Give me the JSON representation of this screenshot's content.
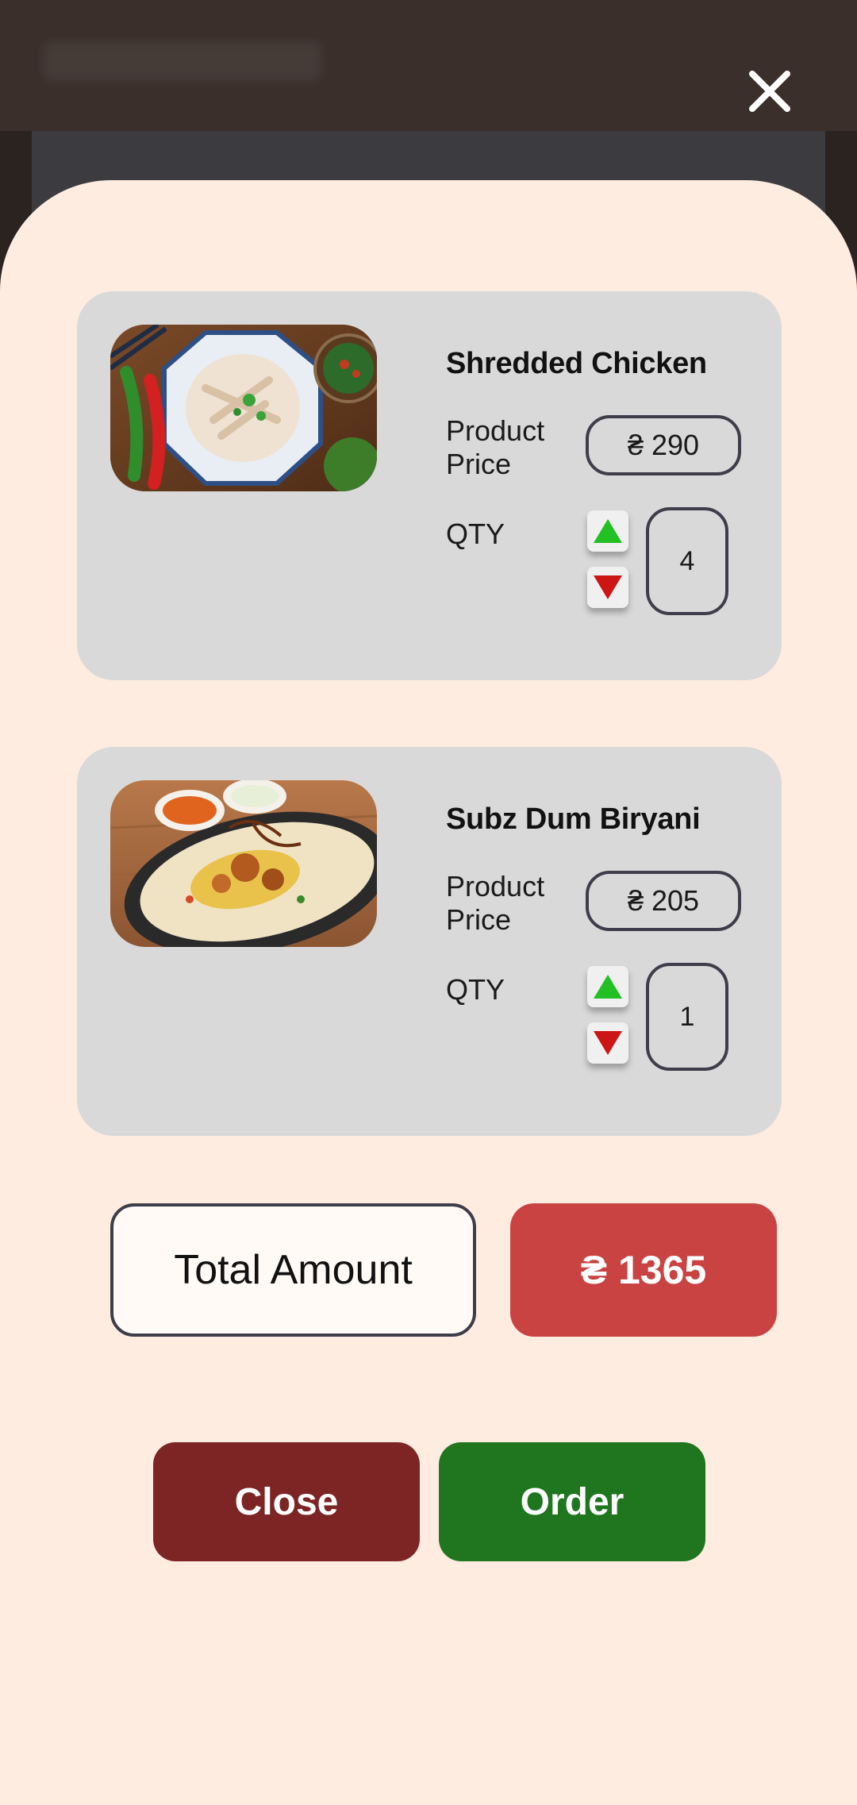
{
  "header": {
    "close_icon": "close-icon"
  },
  "cart": {
    "items": [
      {
        "name": "Shredded Chicken",
        "price_label": "Product\nPrice",
        "price": "₴ 290",
        "qty_label": "QTY",
        "qty": "4",
        "image": "shredded-chicken-photo"
      },
      {
        "name": "Subz Dum Biryani",
        "price_label": "Product\nPrice",
        "price": "₴ 205",
        "qty_label": "QTY",
        "qty": "1",
        "image": "biryani-photo"
      }
    ],
    "total_label": "Total Amount",
    "total_value": "₴ 1365"
  },
  "actions": {
    "close_label": "Close",
    "order_label": "Order"
  },
  "colors": {
    "sheet_bg": "#ffece0",
    "card_bg": "#d9d9d9",
    "total_accent": "#c94343",
    "close_button": "#7d2525",
    "order_button": "#1f761f",
    "arrow_up": "#22c022",
    "arrow_down": "#cc1515"
  }
}
